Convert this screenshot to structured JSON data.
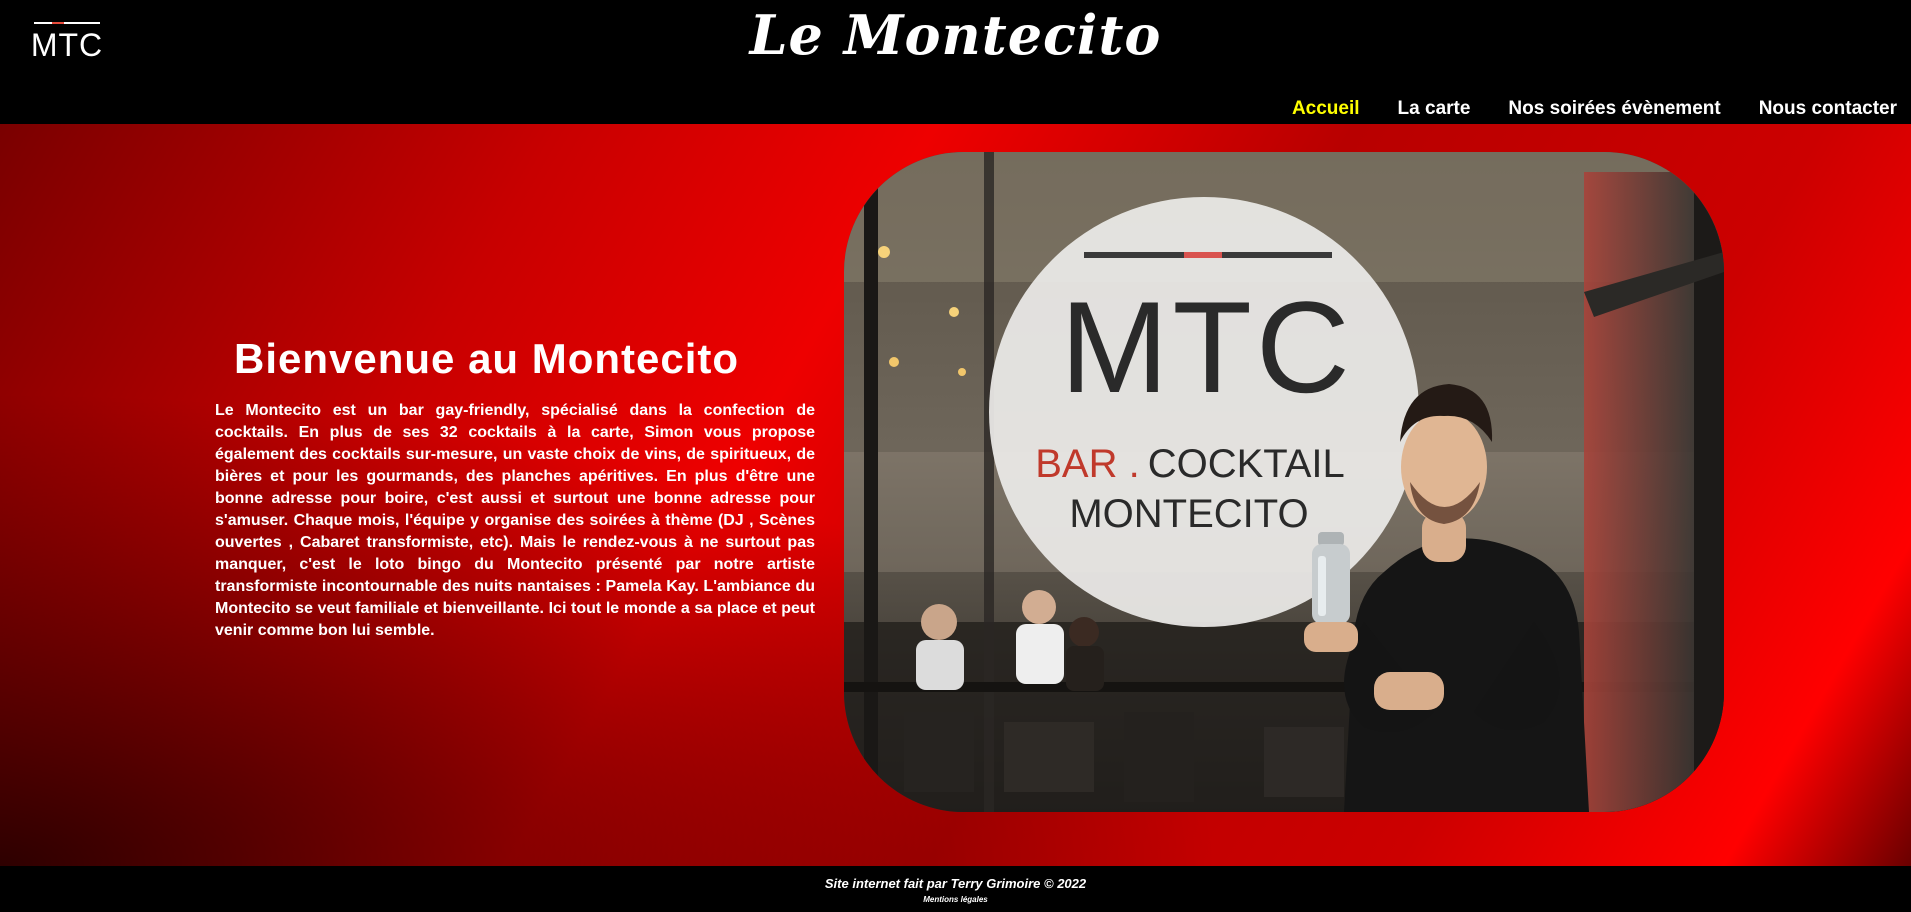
{
  "header": {
    "site_title": "Le Montecito",
    "logo_text": "MTC",
    "nav": [
      {
        "label": "Accueil",
        "active": true
      },
      {
        "label": "La carte",
        "active": false
      },
      {
        "label": "Nos soirées évènement",
        "active": false
      },
      {
        "label": "Nous contacter",
        "active": false
      }
    ]
  },
  "main": {
    "heading": "Bienvenue au Montecito",
    "intro": "Le Montecito est un bar gay-friendly, spécialisé dans la confection de cocktails. En plus de ses 32 cocktails à la carte, Simon vous propose également des cocktails sur-mesure, un vaste choix de vins, de spiritueux, de bières et pour les gourmands, des planches apéritives. En plus d'être une bonne adresse pour boire, c'est aussi et surtout une bonne adresse pour s'amuser. Chaque mois, l'équipe y organise des soirées à thème (DJ , Scènes ouvertes , Cabaret transformiste, etc). Mais le rendez-vous à ne surtout pas manquer, c'est le loto bingo du Montecito présenté par notre artiste transformiste incontournable des nuits nantaises : Pamela Kay. L'ambiance du Montecito se veut familiale et bienveillante. Ici tout le monde a sa place et peut venir comme bon lui semble.",
    "photo": {
      "sign_logo": "MTC",
      "sign_line1_accent": "BAR .",
      "sign_line1": "COCKTAIL",
      "sign_line2": "MONTECITO"
    }
  },
  "footer": {
    "credit": "Site internet fait par Terry Grimoire © 2022",
    "legal": "Mentions légales"
  },
  "colors": {
    "accent_nav": "#ffff00",
    "brand_red": "#e00000",
    "sign_red": "#c0392b"
  }
}
